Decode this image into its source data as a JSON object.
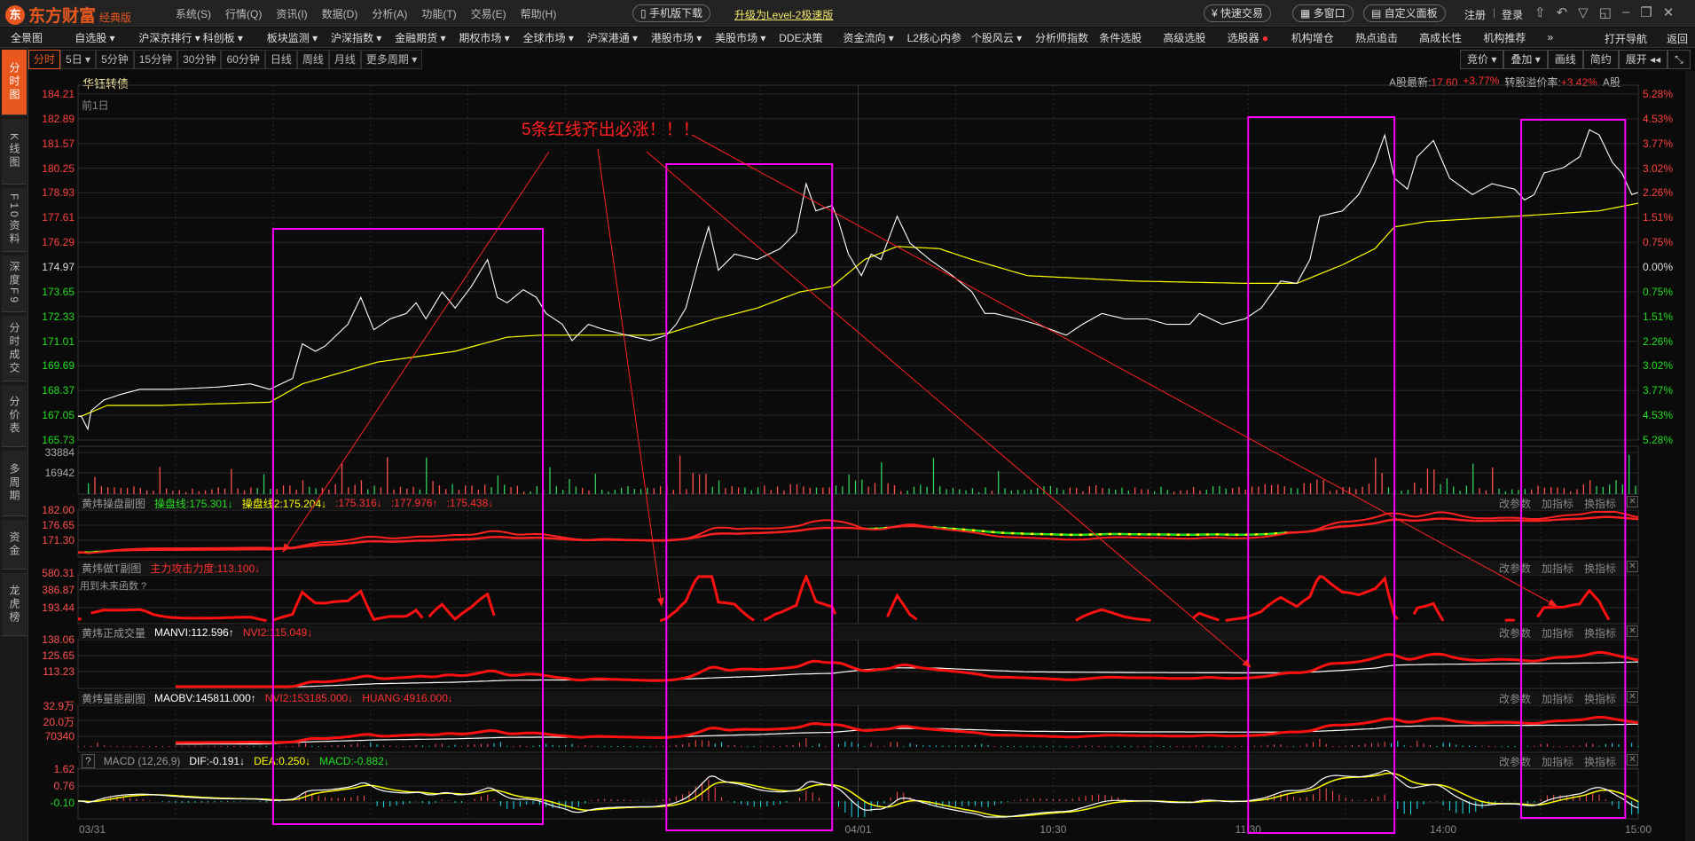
{
  "app": {
    "logo_mark": "东",
    "logo_text": "东方财富",
    "edition": "经典版",
    "menus": [
      "系统(S)",
      "行情(Q)",
      "资讯(I)",
      "数据(D)",
      "分析(A)",
      "功能(T)",
      "交易(E)",
      "帮助(H)"
    ],
    "mobile_download": "手机版下载",
    "upgrade": "升级为Level-2极速版",
    "quick_trade": "快速交易",
    "multi_window": "多窗口",
    "custom_panel": "自定义面板",
    "register": "注册",
    "login": "登录"
  },
  "navbar": {
    "items": [
      "全景图",
      "自选股 ▾",
      "沪深京排行 ▾",
      "科创板 ▾",
      "板块监测 ▾",
      "沪深指数 ▾",
      "金融期货 ▾",
      "期权市场 ▾",
      "全球市场 ▾",
      "沪深港通 ▾",
      "港股市场 ▾",
      "美股市场 ▾",
      "DDE决策",
      "资金流向 ▾",
      "L2核心内参",
      "个股风云 ▾",
      "分析师指数",
      "条件选股",
      "高级选股",
      "选股器",
      "机构增仓",
      "热点追击",
      "高成长性",
      "机构推荐",
      "»"
    ],
    "open_nav": "打开导航",
    "back": "返回"
  },
  "period_tabs": [
    "分时",
    "5日 ▾",
    "5分钟",
    "15分钟",
    "30分钟",
    "60分钟",
    "日线",
    "周线",
    "月线",
    "更多周期 ▾"
  ],
  "toolbar_right": [
    "竞价 ▾",
    "叠加 ▾",
    "画线",
    "简约",
    "展开 ◂◂",
    "⤡"
  ],
  "sidebar": [
    "分时图",
    "K线图",
    "F10资料",
    "深度F9",
    "分时成交",
    "分价表",
    "多周期",
    "资金",
    "龙虎榜"
  ],
  "quote": {
    "name": "华钰转债",
    "prev_day": "前1日",
    "a_latest_label": "A股最新:",
    "a_latest_price": "17.60",
    "a_latest_change": "+3.77%",
    "premium_label": "转股溢价率:",
    "premium_value": "+3.42%",
    "a_share": "A股"
  },
  "main_axis": {
    "left": [
      "184.21",
      "182.89",
      "181.57",
      "180.25",
      "178.93",
      "177.61",
      "176.29",
      "174.97",
      "173.65",
      "172.33",
      "171.01",
      "169.69",
      "168.37",
      "167.05",
      "165.73"
    ],
    "right": [
      "5.28%",
      "4.53%",
      "3.77%",
      "3.02%",
      "2.26%",
      "1.51%",
      "0.75%",
      "0.00%",
      "0.75%",
      "1.51%",
      "2.26%",
      "3.02%",
      "3.77%",
      "4.53%",
      "5.28%"
    ],
    "price_min": 165.73,
    "price_max": 184.21
  },
  "volume_axis": [
    "33884",
    "16942"
  ],
  "panel_actions": [
    "改参数",
    "加指标",
    "换指标",
    "✕"
  ],
  "panels": [
    {
      "name": "黄炜操盘副图",
      "values": [
        {
          "text": "操盘线:175.301↓",
          "color": "#22dd22"
        },
        {
          "text": "操盘线2:175.204↓",
          "color": "#ffff00"
        },
        {
          "text": ":175.316↓",
          "color": "#ff3030"
        },
        {
          "text": ":177.976↑",
          "color": "#ff3030"
        },
        {
          "text": ":175.438↓",
          "color": "#ff3030"
        }
      ],
      "axis": [
        "182.00",
        "176.65",
        "171.30"
      ]
    },
    {
      "name": "黄炜做T副图",
      "values": [
        {
          "text": "主力攻击力度:113.100↓",
          "color": "#ff3030"
        }
      ],
      "axis": [
        "580.31",
        "386.87",
        "193.44"
      ],
      "note": "用到未来函数 ?"
    },
    {
      "name": "黄炜正成交量",
      "values": [
        {
          "text": "MANVI:112.596↑",
          "color": "#ffffff"
        },
        {
          "text": "NVI2:115.049↓",
          "color": "#ff3030"
        }
      ],
      "axis": [
        "138.06",
        "125.65",
        "113.23"
      ]
    },
    {
      "name": "黄炜量能副图",
      "values": [
        {
          "text": "MAOBV:145811.000↑",
          "color": "#ffffff"
        },
        {
          "text": "NVI2:153185.000↓",
          "color": "#ff3030"
        },
        {
          "text": "HUANG:4916.000↓",
          "color": "#ff3030"
        }
      ],
      "axis": [
        "32.9万",
        "20.0万",
        "70340"
      ]
    },
    {
      "name": "MACD (12,26,9)",
      "help": "?",
      "values": [
        {
          "text": "DIF:-0.191↓",
          "color": "#ffffff"
        },
        {
          "text": "DEA:0.250↓",
          "color": "#ffff00"
        },
        {
          "text": "MACD:-0.882↓",
          "color": "#22dd22"
        }
      ],
      "axis": [
        "1.62",
        "0.76",
        "-0.10"
      ]
    }
  ],
  "time_axis": [
    "03/31",
    "04/01",
    "10:30",
    "11:30",
    "14:00",
    "15:00"
  ],
  "annotation": {
    "text": "5条红线齐出必涨！！！"
  },
  "colors": {
    "accent": "#e8571e",
    "up": "#ff3030",
    "down": "#22dd22",
    "avg": "#ffff00",
    "box": "#ff00ff"
  },
  "chart_data": {
    "type": "line",
    "x_unit": "trading minute over two sessions (0-480)",
    "price": [
      [
        1,
        167.0
      ],
      [
        3,
        166.31
      ],
      [
        4,
        167.29
      ],
      [
        8,
        167.87
      ],
      [
        13,
        168.16
      ],
      [
        19,
        168.44
      ],
      [
        29,
        168.44
      ],
      [
        43,
        168.56
      ],
      [
        53,
        168.73
      ],
      [
        59,
        168.44
      ],
      [
        66,
        169.02
      ],
      [
        69,
        170.87
      ],
      [
        73,
        170.47
      ],
      [
        76,
        170.75
      ],
      [
        83,
        171.91
      ],
      [
        87,
        173.35
      ],
      [
        91,
        171.62
      ],
      [
        96,
        172.2
      ],
      [
        101,
        172.49
      ],
      [
        104,
        173.06
      ],
      [
        107,
        172.2
      ],
      [
        112,
        173.64
      ],
      [
        116,
        172.78
      ],
      [
        121,
        173.93
      ],
      [
        126,
        175.37
      ],
      [
        129,
        173.35
      ],
      [
        132,
        173.06
      ],
      [
        137,
        173.76
      ],
      [
        141,
        173.35
      ],
      [
        144,
        172.49
      ],
      [
        149,
        171.91
      ],
      [
        152,
        171.04
      ],
      [
        157,
        171.91
      ],
      [
        162,
        171.62
      ],
      [
        169,
        171.33
      ],
      [
        176,
        171.04
      ],
      [
        181,
        171.33
      ],
      [
        184,
        171.91
      ],
      [
        187,
        172.78
      ],
      [
        191,
        175.37
      ],
      [
        194,
        177.11
      ],
      [
        197,
        174.8
      ],
      [
        202,
        175.66
      ],
      [
        209,
        175.37
      ],
      [
        216,
        175.95
      ],
      [
        221,
        176.82
      ],
      [
        224,
        179.42
      ],
      [
        227,
        177.97
      ],
      [
        232,
        178.26
      ],
      [
        234,
        177.4
      ],
      [
        237,
        175.66
      ],
      [
        241,
        174.51
      ],
      [
        244,
        175.66
      ],
      [
        247,
        175.37
      ],
      [
        252,
        177.68
      ],
      [
        256,
        176.24
      ],
      [
        262,
        175.37
      ],
      [
        269,
        174.51
      ],
      [
        275,
        173.64
      ],
      [
        279,
        172.49
      ],
      [
        282,
        172.49
      ],
      [
        289,
        172.2
      ],
      [
        295,
        171.91
      ],
      [
        304,
        171.33
      ],
      [
        309,
        171.91
      ],
      [
        315,
        172.49
      ],
      [
        322,
        172.2
      ],
      [
        329,
        172.2
      ],
      [
        335,
        171.91
      ],
      [
        342,
        171.91
      ],
      [
        345,
        172.49
      ],
      [
        352,
        171.91
      ],
      [
        359,
        172.2
      ],
      [
        364,
        172.78
      ],
      [
        370,
        174.22
      ],
      [
        375,
        174.1
      ],
      [
        379,
        175.37
      ],
      [
        382,
        177.68
      ],
      [
        389,
        177.97
      ],
      [
        394,
        178.84
      ],
      [
        399,
        180.57
      ],
      [
        402,
        182.02
      ],
      [
        405,
        179.71
      ],
      [
        409,
        179.13
      ],
      [
        412,
        180.86
      ],
      [
        417,
        181.73
      ],
      [
        422,
        179.71
      ],
      [
        429,
        178.84
      ],
      [
        435,
        179.42
      ],
      [
        442,
        179.13
      ],
      [
        445,
        178.55
      ],
      [
        448,
        178.84
      ],
      [
        451,
        179.99
      ],
      [
        457,
        180.28
      ],
      [
        462,
        180.86
      ],
      [
        465,
        182.3
      ],
      [
        468,
        182.02
      ],
      [
        472,
        180.57
      ],
      [
        475,
        179.99
      ],
      [
        478,
        178.84
      ],
      [
        480,
        178.95
      ]
    ],
    "average": [
      [
        1,
        167.0
      ],
      [
        9,
        167.58
      ],
      [
        26,
        167.58
      ],
      [
        59,
        167.75
      ],
      [
        69,
        168.73
      ],
      [
        92,
        169.89
      ],
      [
        116,
        170.47
      ],
      [
        132,
        171.22
      ],
      [
        142,
        171.33
      ],
      [
        176,
        171.33
      ],
      [
        182,
        171.45
      ],
      [
        196,
        172.2
      ],
      [
        209,
        172.78
      ],
      [
        222,
        173.64
      ],
      [
        232,
        173.93
      ],
      [
        242,
        175.37
      ],
      [
        252,
        176.07
      ],
      [
        265,
        175.95
      ],
      [
        275,
        175.37
      ],
      [
        292,
        174.51
      ],
      [
        325,
        174.22
      ],
      [
        359,
        174.1
      ],
      [
        375,
        174.1
      ],
      [
        389,
        175.09
      ],
      [
        399,
        175.95
      ],
      [
        405,
        177.11
      ],
      [
        415,
        177.4
      ],
      [
        442,
        177.68
      ],
      [
        468,
        177.97
      ],
      [
        480,
        178.38
      ]
    ],
    "highlight_ranges_minutes": [
      [
        60,
        143
      ],
      [
        181,
        232
      ],
      [
        360,
        405
      ],
      [
        444,
        476
      ]
    ]
  }
}
